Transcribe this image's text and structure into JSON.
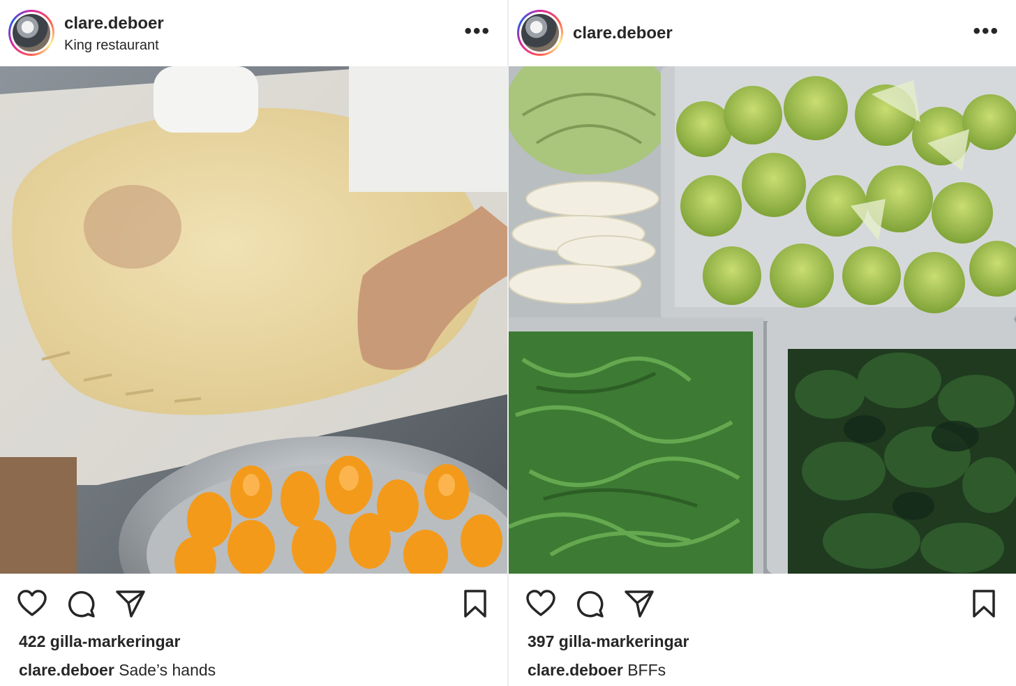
{
  "posts": [
    {
      "username": "clare.deboer",
      "location": "King restaurant",
      "likes": "422 gilla-markeringar",
      "caption_user": "clare.deboer",
      "caption_text": "Sade’s hands",
      "photo": "hands shaping pastry dough with bowl of apricots"
    },
    {
      "username": "clare.deboer",
      "location": "",
      "likes": "397 gilla-markeringar",
      "caption_user": "clare.deboer",
      "caption_text": "BFFs",
      "photo": "steel trays of cabbage, endive, romanesco, arugula and spinach"
    }
  ],
  "icons": {
    "more": "more-options-icon",
    "like": "heart-icon",
    "comment": "comment-bubble-icon",
    "share": "paper-plane-icon",
    "save": "bookmark-icon"
  },
  "more_glyph": "•••"
}
